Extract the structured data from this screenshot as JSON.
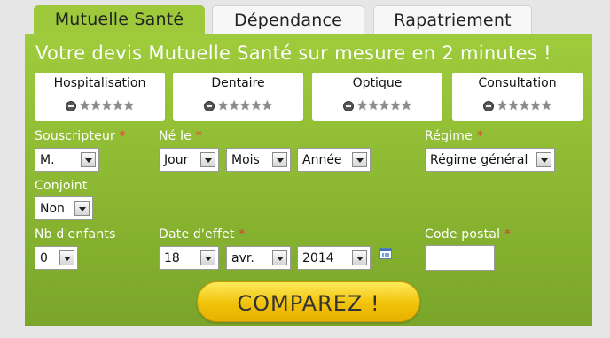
{
  "tabs": [
    {
      "label": "Mutuelle Santé",
      "active": true
    },
    {
      "label": "Dépendance",
      "active": false
    },
    {
      "label": "Rapatriement",
      "active": false
    }
  ],
  "headline": "Votre devis Mutuelle Santé sur mesure en 2 minutes !",
  "coverages": [
    {
      "label": "Hospitalisation",
      "rating": 0,
      "max": 5,
      "minus_icon": "minus-circle-icon",
      "star_icon": "star-icon"
    },
    {
      "label": "Dentaire",
      "rating": 0,
      "max": 5,
      "minus_icon": "minus-circle-icon",
      "star_icon": "star-icon"
    },
    {
      "label": "Optique",
      "rating": 0,
      "max": 5,
      "minus_icon": "minus-circle-icon",
      "star_icon": "star-icon"
    },
    {
      "label": "Consultation",
      "rating": 0,
      "max": 5,
      "minus_icon": "minus-circle-icon",
      "star_icon": "star-icon"
    }
  ],
  "form": {
    "souscripteur": {
      "label": "Souscripteur",
      "required": "*",
      "value": "M."
    },
    "ne_le": {
      "label": "Né le",
      "required": "*",
      "day": "Jour",
      "month": "Mois",
      "year": "Année"
    },
    "regime": {
      "label": "Régime",
      "required": "*",
      "value": "Régime général"
    },
    "conjoint": {
      "label": "Conjoint",
      "value": "Non"
    },
    "nb_enfants": {
      "label": "Nb d'enfants",
      "value": "0"
    },
    "date_effet": {
      "label": "Date d'effet",
      "required": "*",
      "day": "18",
      "month": "avr.",
      "year": "2014",
      "calendar_icon": "calendar-icon"
    },
    "code_postal": {
      "label": "Code postal",
      "required": "*",
      "value": ""
    }
  },
  "compare_button": "COMPAREZ !",
  "colors": {
    "panel_green": "#8fbd34",
    "button_yellow": "#f4cc1a",
    "required_red": "#e33333",
    "background": "#e6e6e6"
  }
}
